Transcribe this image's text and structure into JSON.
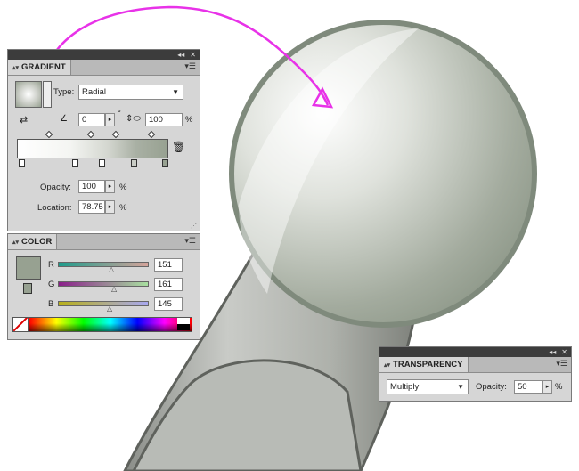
{
  "gradient_panel": {
    "tab_label": "GRADIENT",
    "type_label": "Type:",
    "type_value": "Radial",
    "angle_value": "0",
    "angle_unit": "°",
    "aspect_value": "100",
    "aspect_unit": "%",
    "opacity_label": "Opacity:",
    "opacity_value": "100",
    "opacity_unit": "%",
    "location_label": "Location:",
    "location_value": "78.75",
    "location_unit": "%"
  },
  "color_panel": {
    "tab_label": "COLOR",
    "channels": [
      {
        "label": "R",
        "value": "151"
      },
      {
        "label": "G",
        "value": "161"
      },
      {
        "label": "B",
        "value": "145"
      }
    ],
    "fill_color": "#97a191"
  },
  "transparency_panel": {
    "tab_label": "TRANSPARENCY",
    "blend_mode": "Multiply",
    "opacity_label": "Opacity:",
    "opacity_value": "50",
    "opacity_unit": "%"
  },
  "colors": {
    "annotation": "#e832e8",
    "sphere_rim": "#7f8a7c"
  }
}
